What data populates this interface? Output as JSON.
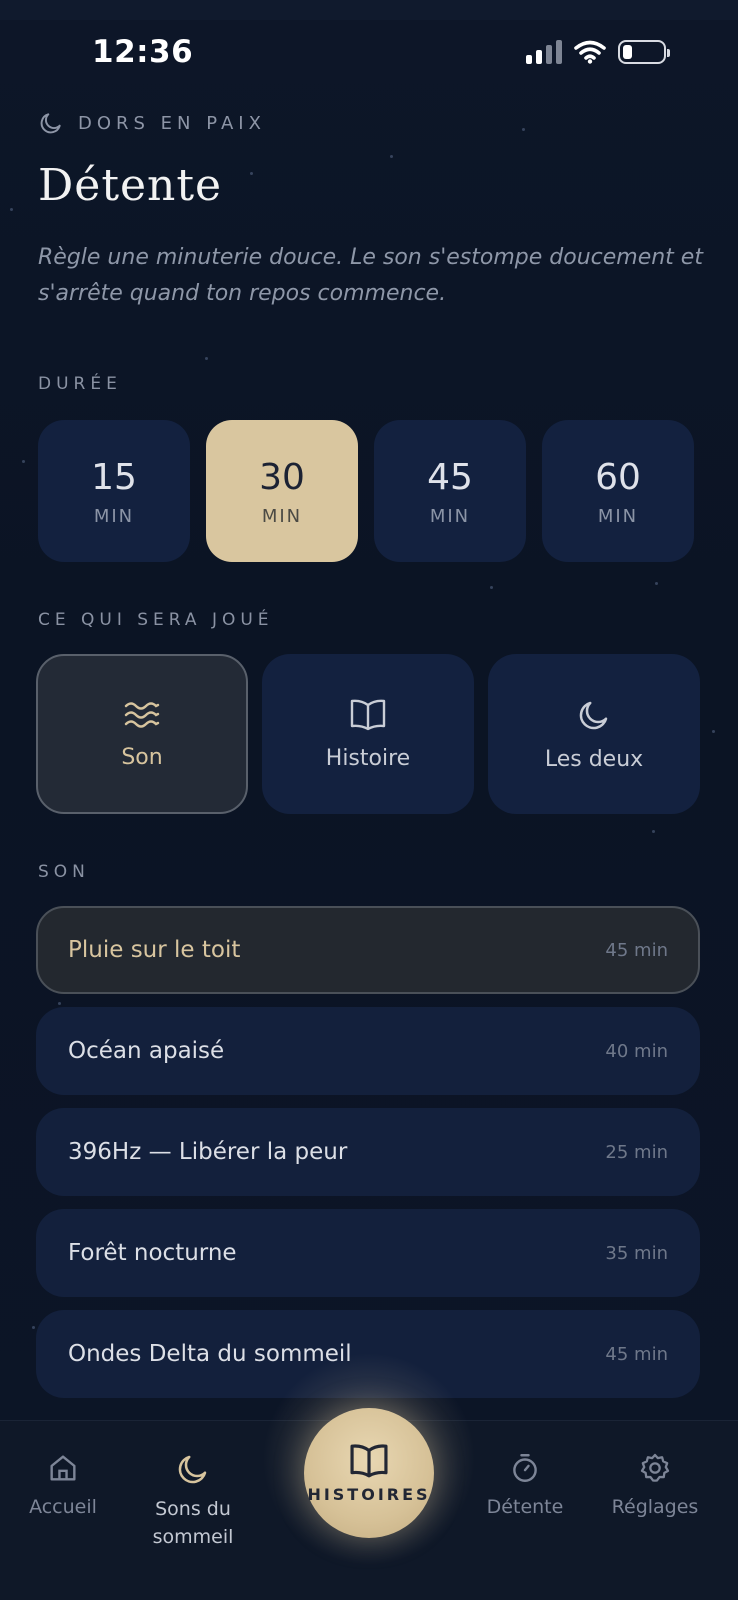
{
  "status_bar": {
    "time": "12:36"
  },
  "header": {
    "eyebrow": "DORS EN PAIX",
    "title": "Détente",
    "subtitle": "Règle une minuterie douce. Le son s'estompe doucement et s'arrête quand ton repos commence."
  },
  "duration": {
    "label": "DURÉE",
    "options": [
      {
        "value": "15",
        "unit": "MIN"
      },
      {
        "value": "30",
        "unit": "MIN"
      },
      {
        "value": "45",
        "unit": "MIN"
      },
      {
        "value": "60",
        "unit": "MIN"
      }
    ],
    "selected": "30"
  },
  "play_mode": {
    "label": "CE QUI SERA JOUÉ",
    "options": [
      {
        "label": "Son",
        "icon": "waves-icon"
      },
      {
        "label": "Histoire",
        "icon": "book-icon"
      },
      {
        "label": "Les deux",
        "icon": "moon-icon"
      }
    ],
    "selected": "Son"
  },
  "sounds": {
    "label": "SON",
    "items": [
      {
        "name": "Pluie sur le toit",
        "duration": "45 min"
      },
      {
        "name": "Océan apaisé",
        "duration": "40 min"
      },
      {
        "name": "396Hz — Libérer la peur",
        "duration": "25 min"
      },
      {
        "name": "Forêt nocturne",
        "duration": "35 min"
      },
      {
        "name": "Ondes Delta du sommeil",
        "duration": "45 min"
      }
    ],
    "selected": "Pluie sur le toit"
  },
  "nav": {
    "home": "Accueil",
    "sleep_sounds_line1": "Sons du",
    "sleep_sounds_line2": "sommeil",
    "stories": "HISTOIRES",
    "relax": "Détente",
    "settings": "Réglages"
  },
  "colors": {
    "background": "#0b1322",
    "card": "#13213f",
    "accent": "#d9c69f",
    "selected_card": "#232a36"
  }
}
